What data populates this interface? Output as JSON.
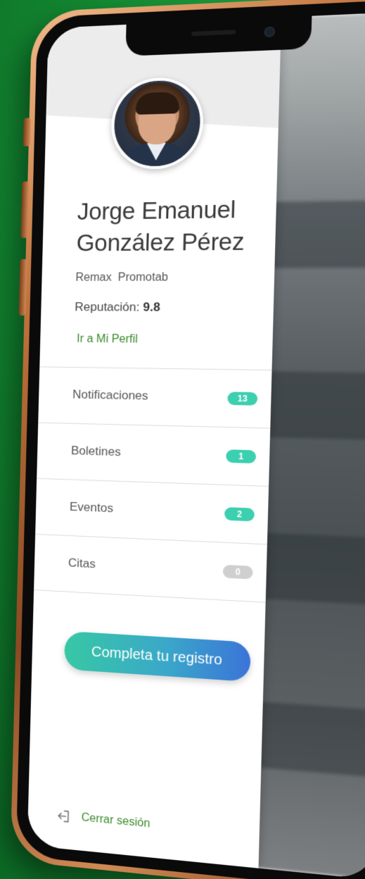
{
  "profile": {
    "name_line1": "Jorge Emanuel",
    "name_line2": "González Pérez",
    "agency": "Remax  Promotab",
    "reputation_label": "Reputación:",
    "reputation_value": "9.8",
    "profile_link": "Ir a Mi Perfil"
  },
  "menu": {
    "items": [
      {
        "label": "Notificaciones",
        "badge": "13",
        "badge_color": "#3ccfb0"
      },
      {
        "label": "Boletines",
        "badge": "1",
        "badge_color": "#3ccfb0"
      },
      {
        "label": "Eventos",
        "badge": "2",
        "badge_color": "#3ccfb0"
      },
      {
        "label": "Citas",
        "badge": "0",
        "badge_color": "#cfcfcf"
      }
    ]
  },
  "actions": {
    "complete_registration": "Completa tu registro",
    "logout": "Cerrar sesión"
  },
  "colors": {
    "accent_green": "#3b8b2a",
    "badge_active": "#3ccfb0",
    "badge_inactive": "#cfcfcf",
    "cta_start": "#37c8a4",
    "cta_end": "#3b74d8",
    "background_green": "#138a32"
  },
  "icons": {
    "logout": "logout-icon",
    "avatar": "user-photo"
  }
}
